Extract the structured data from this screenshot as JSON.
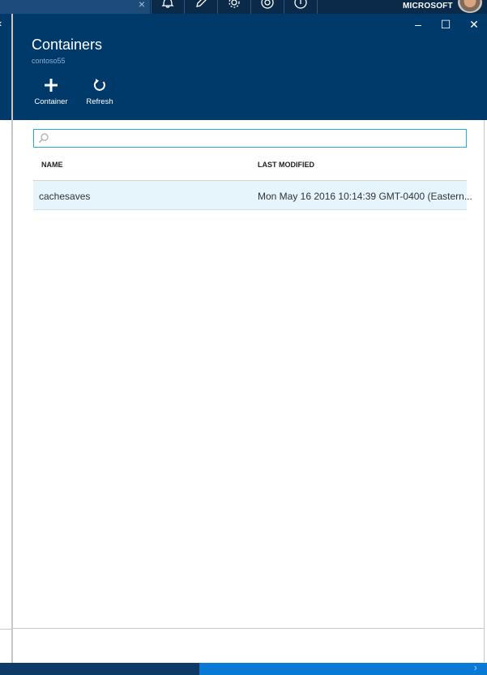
{
  "topbar": {
    "account_name": "MICROSOFT",
    "icons": [
      "notifications-icon",
      "edit-icon",
      "settings-icon",
      "feedback-icon",
      "help-icon"
    ]
  },
  "blade": {
    "title": "Containers",
    "subtitle": "contoso55",
    "window_controls": {
      "minimize": "–",
      "maximize": "☐",
      "close": "✕"
    },
    "commands": [
      {
        "label": "Container",
        "icon": "plus-icon"
      },
      {
        "label": "Refresh",
        "icon": "refresh-icon"
      }
    ]
  },
  "search": {
    "placeholder": ""
  },
  "table": {
    "columns": [
      "NAME",
      "LAST MODIFIED"
    ],
    "rows": [
      {
        "name": "cachesaves",
        "last_modified": "Mon May 16 2016 10:14:39 GMT-0400 (Eastern..."
      }
    ]
  },
  "colors": {
    "header": "#003a6b",
    "topbar": "#0b2a4a",
    "accent": "#29a9e0",
    "row_selected": "#e6f4fc"
  }
}
